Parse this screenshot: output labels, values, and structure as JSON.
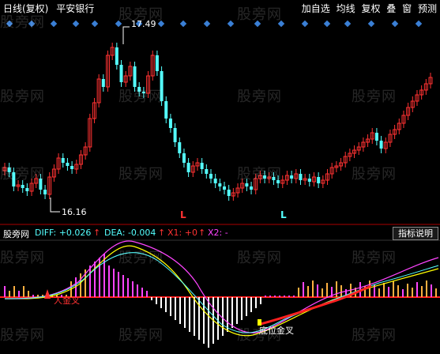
{
  "toolbar": {
    "period": "日线(复权)",
    "stock_name": "平安银行",
    "add_watch": "加自选",
    "ma_line": "均线",
    "adjust": "复权",
    "overlay": "叠",
    "window": "窗",
    "warning": "预测"
  },
  "watermark": "股旁网",
  "main_chart": {
    "high_label": "17.49",
    "low_label": "16.16",
    "signal_L": "L"
  },
  "indicator": {
    "source": "股旁网",
    "diff_label": "DIFF: +0.026",
    "dea_label": "DEA: -0.004",
    "x1_label": "X1: +0",
    "x2_label": "X2: -",
    "help_button": "指标说明",
    "cross_low": "底位金叉",
    "cross_gold": "人金叉"
  },
  "colors": {
    "up": "#ff3232",
    "down": "#54ffff",
    "diff": "#ffffff",
    "dea": "#ffff00",
    "pink": "#ff44ff",
    "diamond": "#3a7fd5"
  }
}
